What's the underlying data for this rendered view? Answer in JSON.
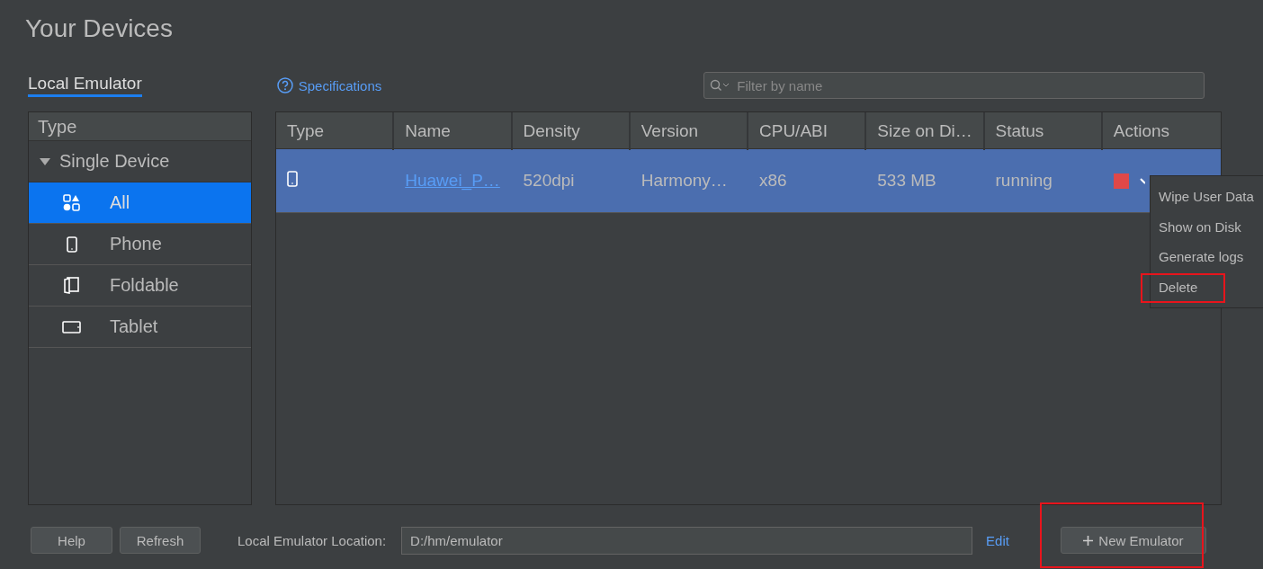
{
  "title": "Your Devices",
  "tabs": [
    {
      "label": "Local Emulator",
      "selected": true
    }
  ],
  "specifications_link": "Specifications",
  "filter": {
    "placeholder": "Filter by name"
  },
  "sidebar": {
    "header": "Type",
    "group": {
      "label": "Single Device",
      "expanded": true,
      "children": [
        {
          "label": "All",
          "kind": "all",
          "selected": true
        },
        {
          "label": "Phone",
          "kind": "phone",
          "selected": false
        },
        {
          "label": "Foldable",
          "kind": "foldable",
          "selected": false
        },
        {
          "label": "Tablet",
          "kind": "tablet",
          "selected": false
        }
      ]
    }
  },
  "table": {
    "columns": [
      "Type",
      "Name",
      "Density",
      "Version",
      "CPU/ABI",
      "Size on Di…",
      "Status",
      "Actions"
    ],
    "rows": [
      {
        "kind": "phone",
        "name": "Huawei_P…",
        "density": "520dpi",
        "version": "Harmony…",
        "cpu": "x86",
        "size": "533 MB",
        "status": "running",
        "selected": true
      }
    ]
  },
  "context_menu": {
    "items": [
      {
        "label": "Wipe User Data",
        "highlighted": false
      },
      {
        "label": "Show on Disk",
        "highlighted": false
      },
      {
        "label": "Generate logs",
        "highlighted": false
      },
      {
        "label": "Delete",
        "highlighted": true
      }
    ]
  },
  "footer": {
    "buttons": [
      "Help",
      "Refresh"
    ],
    "location_label": "Local Emulator Location:",
    "location_value": "D:/hm/emulator",
    "edit_link": "Edit",
    "new_button": {
      "label": "New Emulator",
      "highlighted": true
    }
  }
}
